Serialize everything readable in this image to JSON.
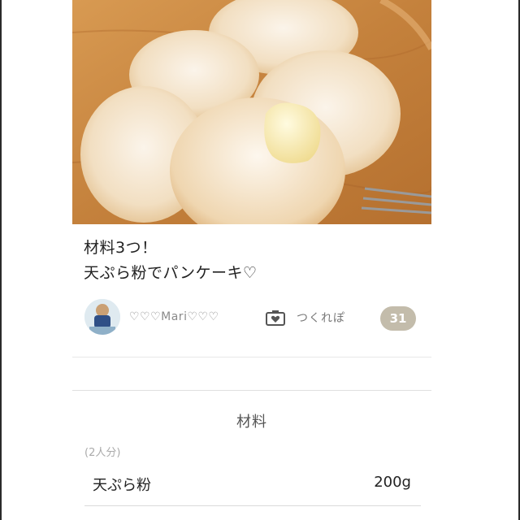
{
  "recipe": {
    "title_line1": "材料3つ！",
    "title_line2": "天ぷら粉でパンケーキ♡"
  },
  "author": {
    "name": "♡♡♡Mari♡♡♡"
  },
  "tsukurepo": {
    "label": "つくれぽ",
    "count": "31"
  },
  "ingredients": {
    "heading": "材料",
    "servings": "(2人分)",
    "items": [
      {
        "name": "天ぷら粉",
        "qty": "200g"
      }
    ]
  },
  "colors": {
    "badge_bg": "#c3bcab",
    "wood": "#c98a45"
  }
}
